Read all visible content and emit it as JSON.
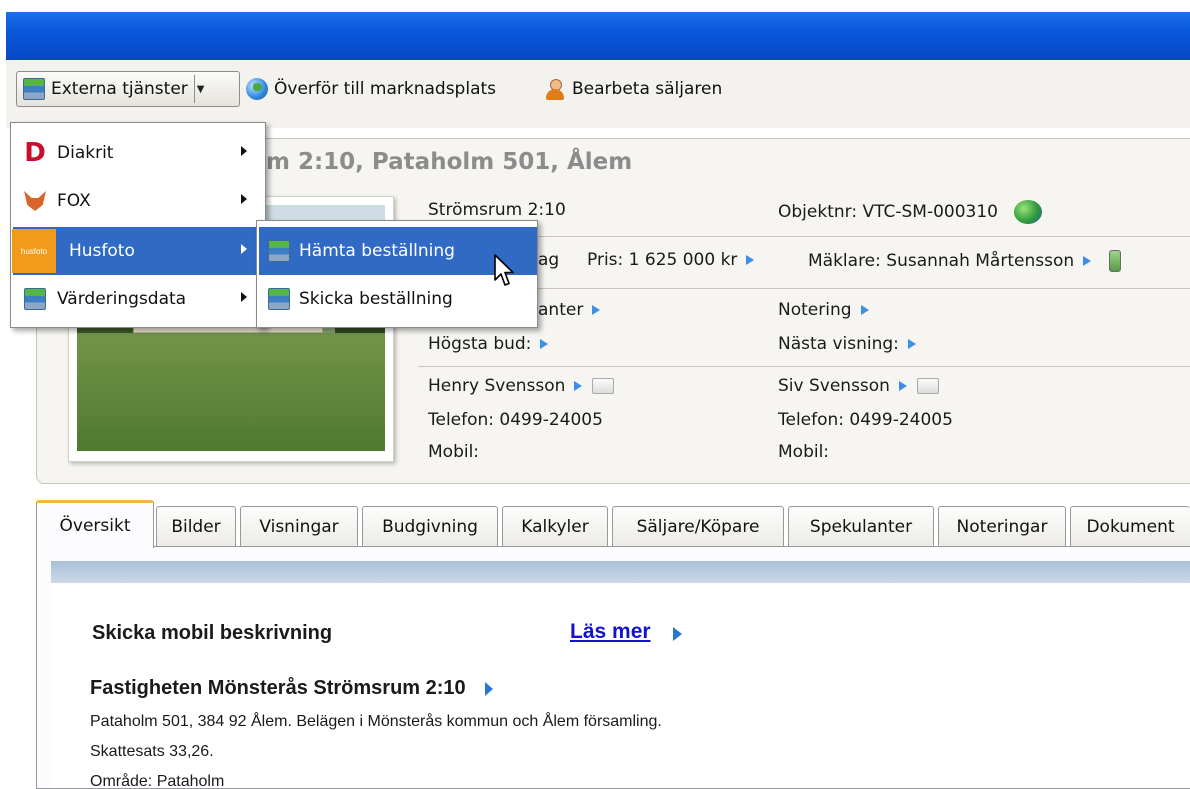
{
  "toolbar": {
    "external_services": "Externa tjänster",
    "transfer": "Överför till marknadsplats",
    "process_seller": "Bearbeta säljaren"
  },
  "property": {
    "title_visible": "m 2:10, Pataholm 501, Ålem",
    "name": "Strömsrum 2:10",
    "object_no": "Objektnr: VTC-SM-000310",
    "status_partial": "ag",
    "price": "Pris: 1 625 000 kr",
    "broker": "Mäklare: Susannah Mårtensson",
    "spec_partial": "anter",
    "listing": "Notering",
    "highest_bid": "Högsta bud:",
    "next_showing": "Nästa visning:"
  },
  "contacts": [
    {
      "name": "Henry Svensson",
      "phone": "Telefon: 0499-24005",
      "mobile": "Mobil:"
    },
    {
      "name": "Siv Svensson",
      "phone": "Telefon: 0499-24005",
      "mobile": "Mobil:"
    }
  ],
  "menu": {
    "items": [
      {
        "label": "Diakrit",
        "icon": "diakrit-logo-icon"
      },
      {
        "label": "FOX",
        "icon": "fox-logo-icon"
      },
      {
        "label": "Husfoto",
        "icon": "husfoto-logo-icon",
        "logo_text": "husfoto"
      },
      {
        "label": "Värderingsdata",
        "icon": "database-icon"
      }
    ],
    "submenu": [
      {
        "label": "Hämta beställning",
        "icon": "download-order-icon"
      },
      {
        "label": "Skicka beställning",
        "icon": "send-order-icon"
      }
    ]
  },
  "tabs": [
    "Översikt",
    "Bilder",
    "Visningar",
    "Budgivning",
    "Kalkyler",
    "Säljare/Köpare",
    "Spekulanter",
    "Noteringar",
    "Dokument"
  ],
  "overview": {
    "mobile_desc": "Skicka mobil beskrivning",
    "read_more": "Läs mer",
    "property_heading": "Fastigheten Mönsterås Strömsrum 2:10",
    "address_line": "Pataholm 501, 384 92 Ålem. Belägen i Mönsterås kommun och Ålem församling.",
    "tax_line": "Skattesats 33,26.",
    "area_line": "Område: Pataholm"
  },
  "colors": {
    "titlebar": "#0a57dc",
    "menu_highlight": "#316ac5",
    "link": "#1313cc",
    "active_tab_accent": "#f7b53c"
  }
}
